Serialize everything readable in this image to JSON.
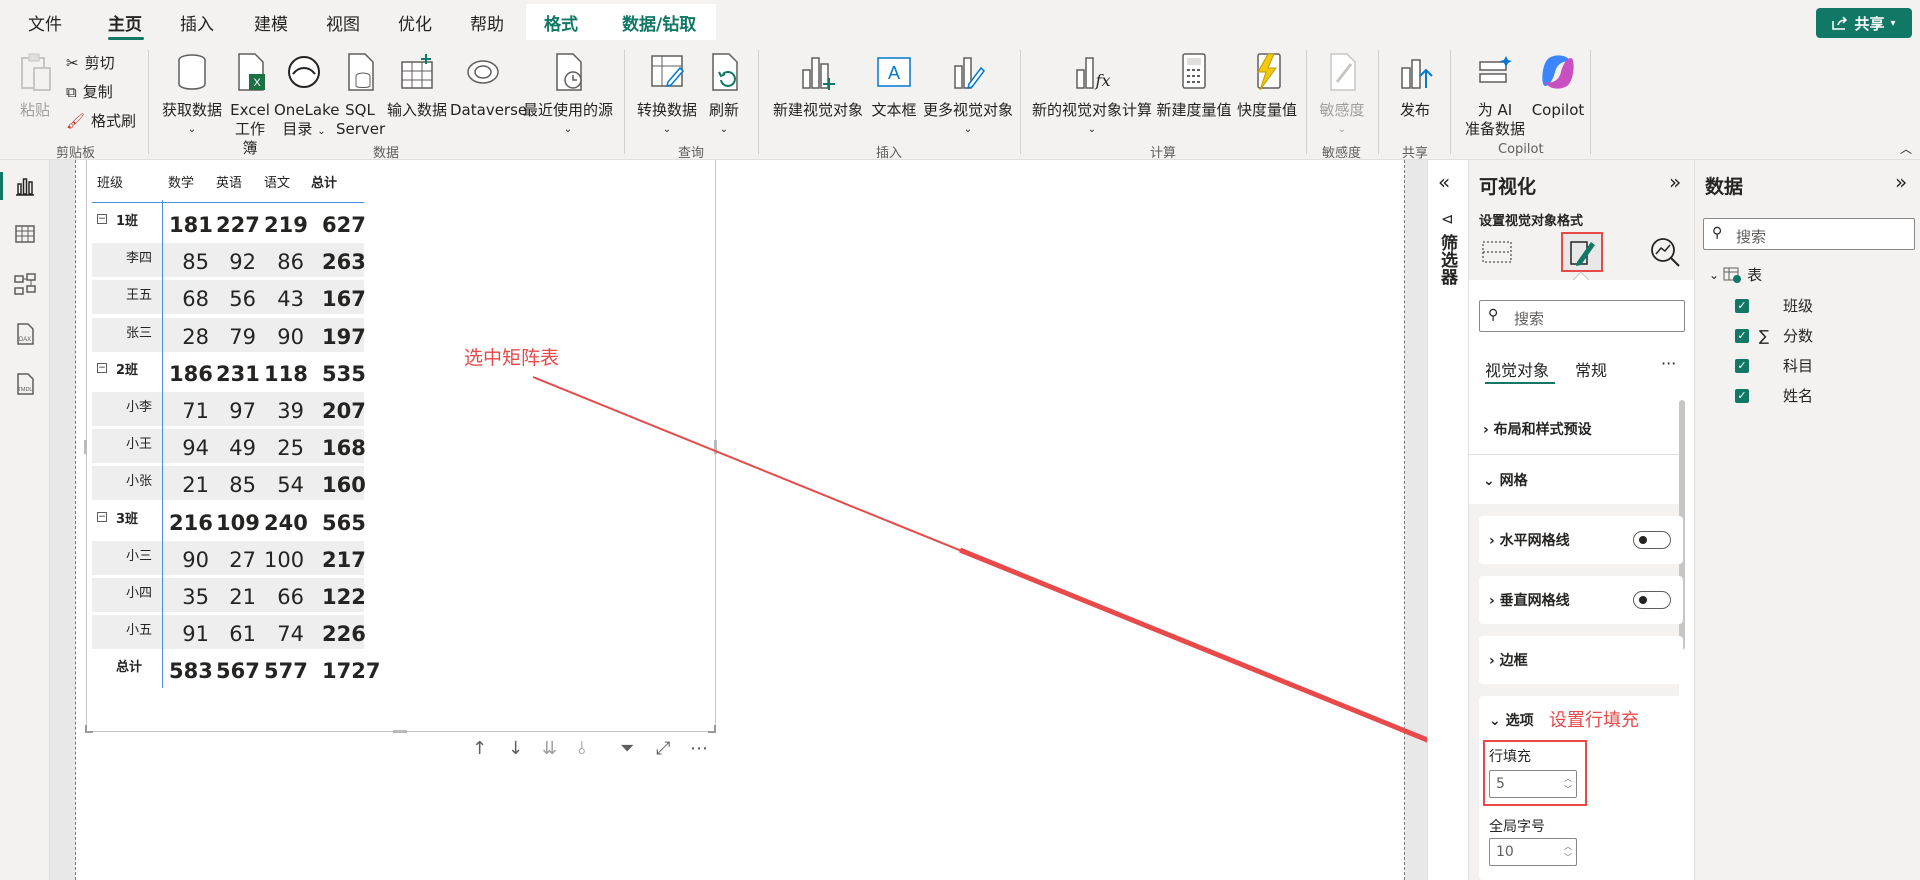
{
  "menu": {
    "file": "文件",
    "home": "主页",
    "insert": "插入",
    "modeling": "建模",
    "view": "视图",
    "optimize": "优化",
    "help": "帮助",
    "format": "格式",
    "data_drill": "数据/钻取",
    "share": "共享"
  },
  "ribbon": {
    "clipboard": {
      "paste": "粘贴",
      "cut": "剪切",
      "copy": "复制",
      "format_painter": "格式刷",
      "label": "剪贴板"
    },
    "data": {
      "get_data": "获取数据",
      "excel_1": "Excel",
      "excel_2": "工作簿",
      "onelake_1": "OneLake",
      "onelake_2": "目录",
      "sql_1": "SQL",
      "sql_2": "Server",
      "enter_data": "输入数据",
      "dataverse": "Dataverse",
      "recent": "最近使用的源",
      "label": "数据"
    },
    "query": {
      "transform": "转换数据",
      "refresh": "刷新",
      "label": "查询"
    },
    "insert": {
      "new_visual": "新建视觉对象",
      "textbox": "文本框",
      "more_visuals": "更多视觉对象",
      "label": "插入"
    },
    "calc": {
      "new_visual_calc": "新的视觉对象计算",
      "new_measure": "新建度量值",
      "quick_measure": "快度量值",
      "label": "计算"
    },
    "sensitivity": {
      "button": "敏感度",
      "label": "敏感度"
    },
    "share": {
      "publish": "发布",
      "label": "共享"
    },
    "copilot": {
      "ai_1": "为 AI",
      "ai_2": "准备数据",
      "copilot": "Copilot",
      "label": "Copilot"
    }
  },
  "matrix": {
    "headers": [
      "班级",
      "数学",
      "英语",
      "语文",
      "总计"
    ],
    "rows": [
      {
        "label": "1班",
        "values": [
          "181",
          "227",
          "219",
          "627"
        ],
        "group": true
      },
      {
        "label": "李四",
        "values": [
          "85",
          "92",
          "86",
          "263"
        ],
        "group": false
      },
      {
        "label": "王五",
        "values": [
          "68",
          "56",
          "43",
          "167"
        ],
        "group": false
      },
      {
        "label": "张三",
        "values": [
          "28",
          "79",
          "90",
          "197"
        ],
        "group": false
      },
      {
        "label": "2班",
        "values": [
          "186",
          "231",
          "118",
          "535"
        ],
        "group": true
      },
      {
        "label": "小李",
        "values": [
          "71",
          "97",
          "39",
          "207"
        ],
        "group": false
      },
      {
        "label": "小王",
        "values": [
          "94",
          "49",
          "25",
          "168"
        ],
        "group": false
      },
      {
        "label": "小张",
        "values": [
          "21",
          "85",
          "54",
          "160"
        ],
        "group": false
      },
      {
        "label": "3班",
        "values": [
          "216",
          "109",
          "240",
          "565"
        ],
        "group": true
      },
      {
        "label": "小三",
        "values": [
          "90",
          "27",
          "100",
          "217"
        ],
        "group": false
      },
      {
        "label": "小四",
        "values": [
          "35",
          "21",
          "66",
          "122"
        ],
        "group": false
      },
      {
        "label": "小五",
        "values": [
          "91",
          "61",
          "74",
          "226"
        ],
        "group": false
      },
      {
        "label": "总计",
        "values": [
          "583",
          "567",
          "577",
          "1727"
        ],
        "group": true
      }
    ]
  },
  "annotations": {
    "select_matrix": "选中矩阵表",
    "set_row_padding": "设置行填充"
  },
  "filters": {
    "label": "筛选器"
  },
  "viz_pane": {
    "title": "可视化",
    "subtitle": "设置视觉对象格式",
    "search_placeholder": "搜索",
    "tab_visual": "视觉对象",
    "tab_general": "常规",
    "more": "···",
    "layout_presets": "布局和样式预设",
    "grid": "网格",
    "h_gridlines": "水平网格线",
    "v_gridlines": "垂直网格线",
    "border": "边框",
    "options": "选项",
    "row_padding_label": "行填充",
    "row_padding_value": "5",
    "global_font_label": "全局字号",
    "global_font_value": "10"
  },
  "data_pane": {
    "title": "数据",
    "search_placeholder": "搜索",
    "table": "表",
    "fields": [
      "班级",
      "分数",
      "科目",
      "姓名"
    ]
  }
}
